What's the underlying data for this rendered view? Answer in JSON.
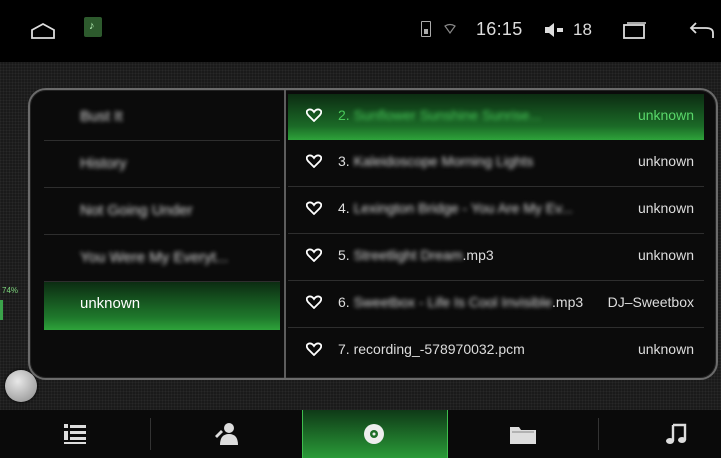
{
  "status_bar": {
    "time": "16:15",
    "volume": "18",
    "icons": [
      "home-icon",
      "music-app-icon",
      "phone-icon",
      "wifi-icon",
      "volume-icon",
      "recent-apps-icon",
      "back-icon"
    ]
  },
  "edge_indicator": "74%",
  "artists": [
    {
      "label": "Bust It",
      "blurred": true
    },
    {
      "label": "History",
      "blurred": true
    },
    {
      "label": "Not Going Under",
      "blurred": true
    },
    {
      "label": "You Were My Everyt...",
      "blurred": true
    },
    {
      "label": "unknown",
      "blurred": false,
      "selected": true
    }
  ],
  "tracks": [
    {
      "number": "2.",
      "title": "Sunflower Sunshine Sunrise...",
      "artist": "unknown",
      "selected": true,
      "blurred": true
    },
    {
      "number": "3.",
      "title": "Kaleidoscope Morning Lights",
      "artist": "unknown",
      "blurred": true
    },
    {
      "number": "4.",
      "title": "Lexington Bridge - You Are My Ev...",
      "artist": "unknown",
      "blurred": true
    },
    {
      "number": "5.",
      "title": "Streetlight Dream",
      "suffix": ".mp3",
      "artist": "unknown",
      "blurred": true
    },
    {
      "number": "6.",
      "title": "Sweetbox - Life Is Cool Invisible",
      "suffix": ".mp3",
      "artist": "DJ–Sweetbox",
      "blurred": true
    },
    {
      "number": "7.",
      "title": "recording_-578970032.pcm",
      "artist": "unknown",
      "blurred": false
    }
  ],
  "nav": [
    {
      "name": "playlist-icon",
      "selected": false
    },
    {
      "name": "artist-icon",
      "selected": false
    },
    {
      "name": "album-icon",
      "selected": true
    },
    {
      "name": "folder-icon",
      "selected": false
    },
    {
      "name": "song-icon",
      "selected": false
    }
  ],
  "colors": {
    "accent": "#2ea33a",
    "accent_text": "#49c95a"
  }
}
